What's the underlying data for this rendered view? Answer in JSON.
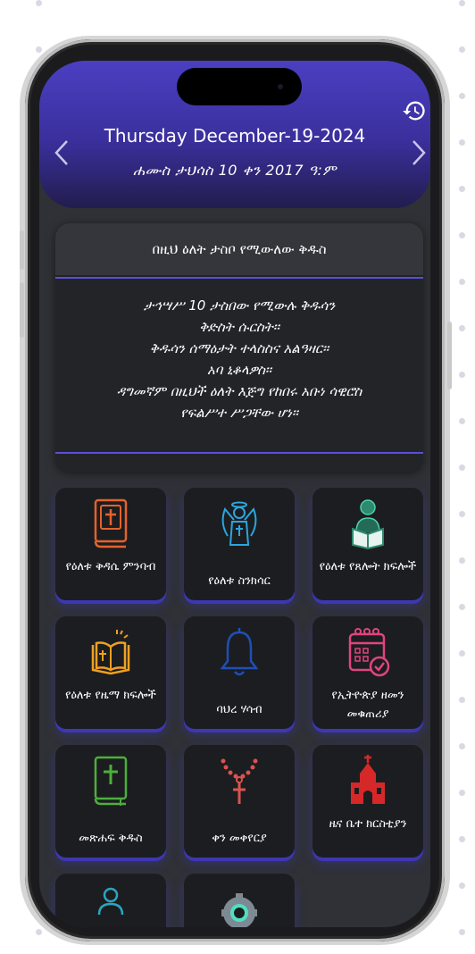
{
  "header": {
    "date_english": "Thursday December-19-2024",
    "date_amharic": "ሐሙስ ታህሳስ  10 ቀን 2017 ዓ:ም"
  },
  "reading": {
    "title": "በዚህ ዕለት ታስቦ የሚውለው ቅዱስ",
    "lines": [
      "ታኅሣሥ 10 ታስበው የሚውሉ ቅዱሳን",
      "ቅድስት ሱርስት፡፡",
      "ቅዱሳን ሰማዕታት ተላስስና አልዓዛር፡፡",
      "አባ ኒቆላዎስ፡፡",
      "ዳግመኛም በዚህች ዕለት እጅግ የከበሩ አቡነ ሳዊሮስ",
      "የፍልሥተ ሥጋቸው ሆነ፡፡"
    ]
  },
  "tiles": [
    {
      "label": "የዕለቱ ቅዳሴ ምንባብ",
      "icon": "bible-book-icon"
    },
    {
      "label": "የዕለቱ ስንክሳር",
      "icon": "angel-icon"
    },
    {
      "label": "የዕለቱ የጸሎት ክፍሎች",
      "icon": "reading-person-icon"
    },
    {
      "label": "የዕለቱ የዜማ ክፍሎች",
      "icon": "open-book-icon"
    },
    {
      "label": "ባህረ ሃሳብ",
      "icon": "bell-icon"
    },
    {
      "label": "የኢትዮጵያ ዘመን መቁጠሪያ",
      "icon": "calendar-icon"
    },
    {
      "label": "መጽሐፍ ቅዱስ",
      "icon": "holy-bible-icon"
    },
    {
      "label": "ቀን መቀየርያ",
      "icon": "rosary-cross-icon"
    },
    {
      "label": "ዜና ቤተ ክርስቲያን",
      "icon": "church-icon"
    }
  ],
  "colors": {
    "accent": "#4b3fc2",
    "tile_glow": "#3d37b3",
    "screen_bg": "#2f3136"
  }
}
